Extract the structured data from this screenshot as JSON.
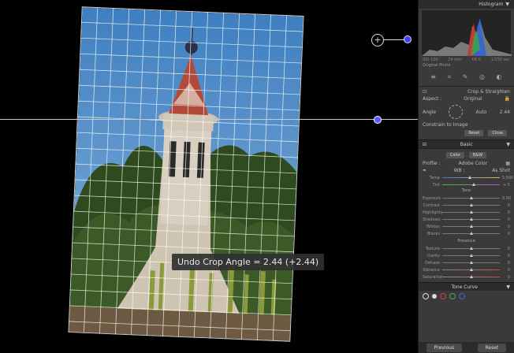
{
  "tooltip": {
    "text": "Undo Crop Angle = 2.44 (+2.44)"
  },
  "panel": {
    "histogram_title": "Histogram",
    "histogram_labels": [
      "ISO 100",
      "24 mm",
      "f/8.0",
      "1/250 sec"
    ],
    "histogram_toggle": "Original Photo",
    "crop_title": "Crop & Straighten",
    "aspect_label": "Aspect :",
    "aspect_value": "Original",
    "angle_label": "Angle",
    "angle_value": "2.44",
    "auto_label": "Auto",
    "constrain_label": "Constrain to Image",
    "reset_label": "Reset",
    "close_label": "Close",
    "basic_title": "Basic",
    "treatment": [
      "Color",
      "B&W"
    ],
    "profile_label": "Profile :",
    "profile_value": "Adobe Color",
    "wb_label": "WB :",
    "wb_value": "As Shot",
    "tone_label": "Tone",
    "presence_label": "Presence",
    "tone_curve_title": "Tone Curve",
    "prev_label": "Previous",
    "reset_bottom_label": "Reset",
    "sliders_wb": [
      {
        "label": "Temp",
        "value": "5,500"
      },
      {
        "label": "Tint",
        "value": "+ 5"
      }
    ],
    "sliders_tone": [
      {
        "label": "Exposure",
        "value": "0.00"
      },
      {
        "label": "Contrast",
        "value": "0"
      },
      {
        "label": "Highlights",
        "value": "0"
      },
      {
        "label": "Shadows",
        "value": "0"
      },
      {
        "label": "Whites",
        "value": "0"
      },
      {
        "label": "Blacks",
        "value": "0"
      }
    ],
    "sliders_presence": [
      {
        "label": "Texture",
        "value": "0"
      },
      {
        "label": "Clarity",
        "value": "0"
      },
      {
        "label": "Dehaze",
        "value": "0"
      },
      {
        "label": "Vibrance",
        "value": "0"
      },
      {
        "label": "Saturation",
        "value": "0"
      }
    ]
  },
  "colors": {
    "accent": "#5a5aff",
    "panel": "#3a3a3a"
  }
}
